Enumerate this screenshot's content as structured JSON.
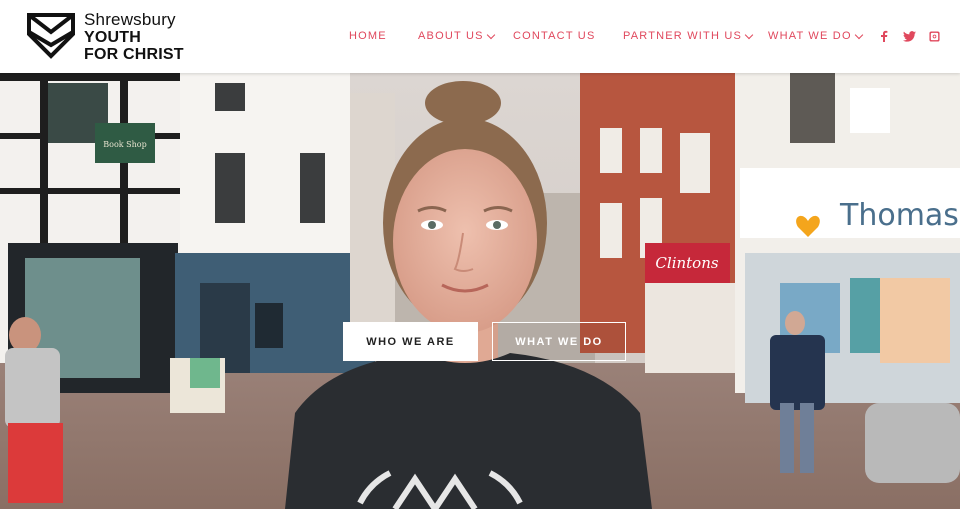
{
  "brand": {
    "line1": "Shrewsbury",
    "line2": "YOUTH",
    "line3": "FOR CHRIST",
    "accent_color": "#e0485d"
  },
  "nav": {
    "items": [
      {
        "label": "HOME",
        "has_dropdown": false
      },
      {
        "label": "ABOUT US",
        "has_dropdown": true
      },
      {
        "label": "CONTACT US",
        "has_dropdown": false
      },
      {
        "label": "PARTNER WITH US",
        "has_dropdown": true
      },
      {
        "label": "WHAT WE DO",
        "has_dropdown": true
      }
    ]
  },
  "social": {
    "icons": [
      "facebook-icon",
      "twitter-icon",
      "instagram-icon"
    ]
  },
  "hero": {
    "shop_sign_left": "Clintons",
    "shop_sign_right": "Thomas C",
    "cta_primary": "WHO WE ARE",
    "cta_secondary": "WHAT WE DO"
  }
}
